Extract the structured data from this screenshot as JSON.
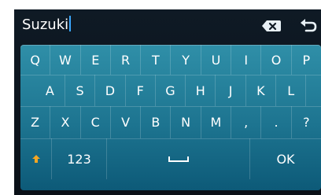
{
  "input": {
    "value": "Suzuki"
  },
  "icons": {
    "delete": "backspace-icon",
    "back": "back-arrow-icon",
    "shift": "shift-arrow-icon",
    "space": "space-bar-icon"
  },
  "keyboard": {
    "row1": [
      "Q",
      "W",
      "E",
      "R",
      "T",
      "Y",
      "U",
      "I",
      "O",
      "P"
    ],
    "row2": [
      "A",
      "S",
      "D",
      "F",
      "G",
      "H",
      "J",
      "K",
      "L"
    ],
    "row3": [
      "Z",
      "X",
      "C",
      "V",
      "B",
      "N",
      "M",
      ",",
      ".",
      "?"
    ],
    "mode_label": "123",
    "ok_label": "OK"
  },
  "colors": {
    "accent_cursor": "#3aa7ff",
    "shift_arrow": "#f4a623",
    "keyboard_top": "#2f8fa8",
    "keyboard_bottom": "#0d5a78"
  }
}
